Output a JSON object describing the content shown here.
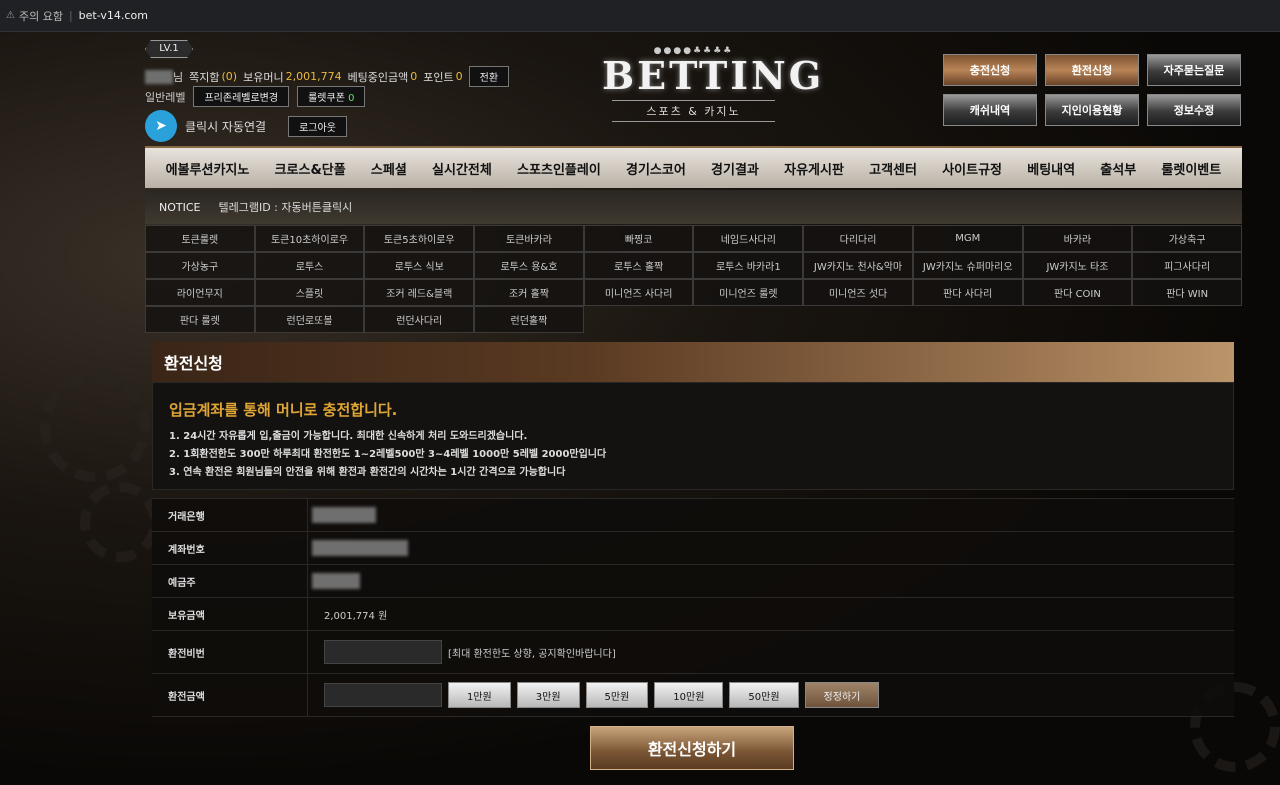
{
  "browser": {
    "warning": "주의 요함",
    "url": "bet-v14.com"
  },
  "user": {
    "level": "LV.1",
    "name_suffix": "님",
    "message_label": "쪽지함",
    "message_count": "(0)",
    "money_label": "보유머니",
    "money_value": "2,001,774",
    "betting_label": "베팅중인금액",
    "betting_value": "0",
    "point_label": "포인트",
    "point_value": "0",
    "convert_button": "전환",
    "level_name": "일반레벨",
    "level_change_button": "프리존레벨로변경",
    "coupon_button": "룰렛쿠폰",
    "coupon_count": "0",
    "telegram_label": "클릭시 자동연결",
    "logout_button": "로그아웃"
  },
  "logo": {
    "dots": "●●●●♣♣♣♣",
    "word": "BETTING",
    "sub": "스포츠 & 카지노"
  },
  "top_buttons": [
    {
      "label": "충전신청",
      "style": "bronze"
    },
    {
      "label": "환전신청",
      "style": "bronze"
    },
    {
      "label": "자주묻는질문",
      "style": "silver"
    },
    {
      "label": "캐쉬내역",
      "style": "silver"
    },
    {
      "label": "지인이용현황",
      "style": "silver"
    },
    {
      "label": "정보수정",
      "style": "silver"
    }
  ],
  "nav": [
    "에볼루션카지노",
    "크로스&단폴",
    "스페셜",
    "실시간전체",
    "스포츠인플레이",
    "경기스코어",
    "경기결과",
    "자유게시판",
    "고객센터",
    "사이트규정",
    "베팅내역",
    "출석부",
    "룰렛이벤트"
  ],
  "notice": {
    "label": "NOTICE",
    "text": "텔레그램ID : 자동버튼클릭시"
  },
  "games": [
    "토큰룰렛",
    "토큰10초하이로우",
    "토큰5초하이로우",
    "토큰바카라",
    "빠찡코",
    "네임드사다리",
    "다리다리",
    "MGM",
    "바카라",
    "가상축구",
    "가상농구",
    "로투스",
    "로투스 식보",
    "로투스 용&호",
    "로투스 홀짝",
    "로투스 바카라1",
    "JW카지노 천사&악마",
    "JW카지노 슈퍼마리오",
    "JW카지노 타조",
    "피그사다리",
    "라이언무지",
    "스플릿",
    "조커 레드&블랙",
    "조커 홀짝",
    "미니언즈 사다리",
    "미니언즈 룰렛",
    "미니언즈 섯다",
    "판다 사다리",
    "판다 COIN",
    "판다 WIN",
    "판다 룰렛",
    "런던로또볼",
    "런던사다리",
    "런던홀짝"
  ],
  "panel": {
    "title": "환전신청",
    "headline": "입금계좌를 통해 머니로 충전합니다.",
    "rules": [
      "1. 24시간 자유롭게 입,출금이 가능합니다. 최대한 신속하게 처리 도와드리겠습니다.",
      "2. 1회환전한도 300만 하루최대 환전한도 1~2레벨500만 3~4레벨 1000만 5레벨 2000만입니다",
      "3. 연속 환전은 회원님들의 안전을 위해 환전과 환전간의 시간차는 1시간 간격으로 가능합니다"
    ],
    "fields": {
      "bank_label": "거래은행",
      "account_label": "계좌번호",
      "holder_label": "예금주",
      "balance_label": "보유금액",
      "balance_value": "2,001,774 원",
      "password_label": "환전비번",
      "password_hint": "[최대 환전한도 상향, 공지확인바랍니다]",
      "amount_label": "환전금액"
    },
    "amount_buttons": [
      "1만원",
      "3만원",
      "5만원",
      "10만원",
      "50만원"
    ],
    "reset_button": "정정하기",
    "submit_button": "환전신청하기"
  }
}
